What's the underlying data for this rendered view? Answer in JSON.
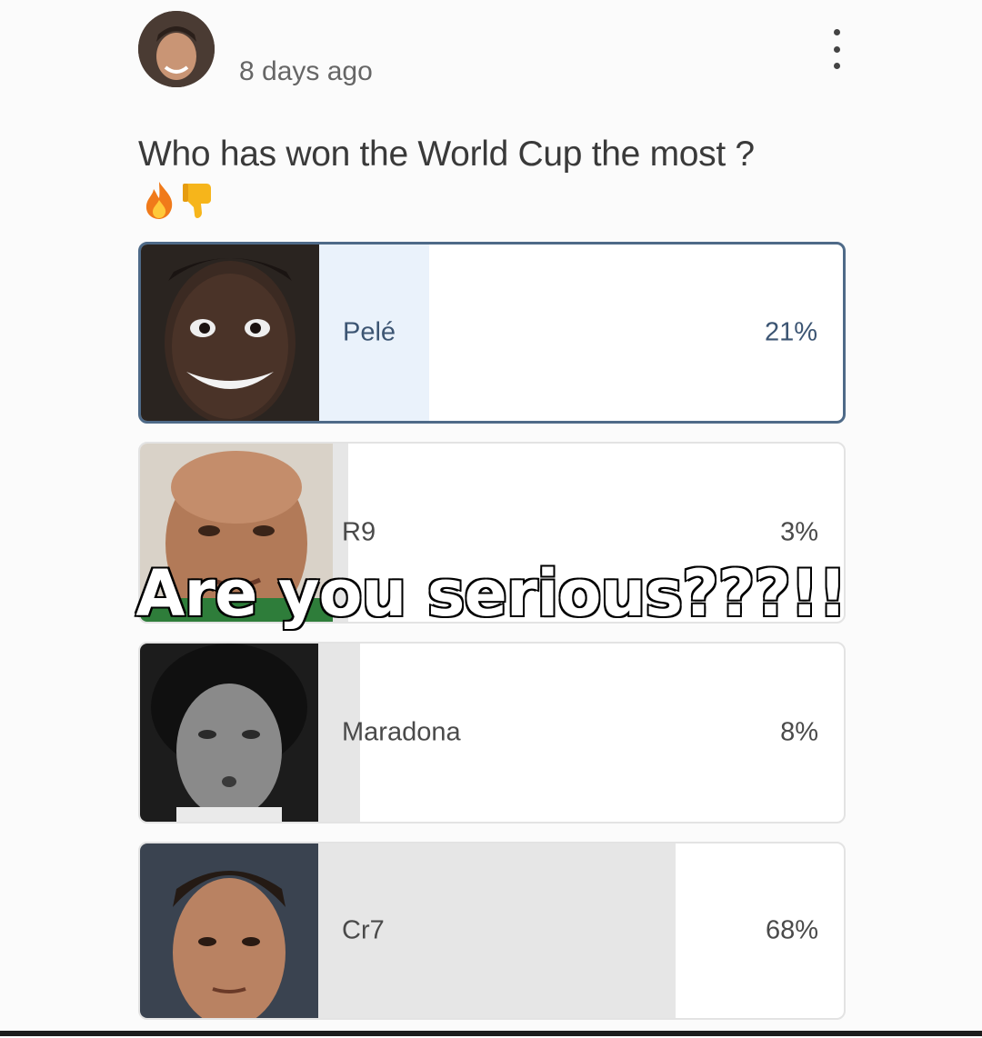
{
  "post": {
    "timestamp": "8 days ago",
    "question": "Who has won the World Cup the most ?",
    "emojis": [
      "fire-emoji",
      "thumbs-down-emoji"
    ]
  },
  "poll": {
    "options": [
      {
        "label": "Pelé",
        "percent": "21%",
        "value": 21,
        "selected": true
      },
      {
        "label": "R9",
        "percent": "3%",
        "value": 3,
        "selected": false
      },
      {
        "label": "Maradona",
        "percent": "8%",
        "value": 8,
        "selected": false
      },
      {
        "label": "Cr7",
        "percent": "68%",
        "value": 68,
        "selected": false
      }
    ]
  },
  "overlay": {
    "caption": "Are you serious???!!"
  },
  "colors": {
    "selected_border": "#4e6a88",
    "selected_bar": "#eaf2fb",
    "bar": "#e6e6e6",
    "overlay_text": "#ffffff"
  }
}
